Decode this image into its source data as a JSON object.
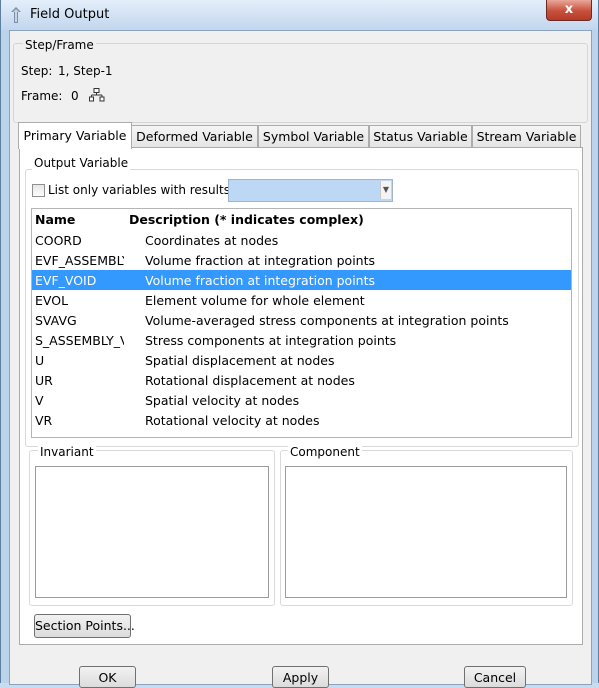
{
  "window": {
    "title": "Field Output",
    "close_glyph": "x"
  },
  "step_frame": {
    "group_label": "Step/Frame",
    "step_label": "Step:",
    "step_value": "1, Step-1",
    "frame_label": "Frame:",
    "frame_value": "0",
    "frame_icon": "tree-icon"
  },
  "tabs": [
    {
      "label": "Primary Variable",
      "active": true
    },
    {
      "label": "Deformed Variable",
      "active": false
    },
    {
      "label": "Symbol Variable",
      "active": false
    },
    {
      "label": "Status Variable",
      "active": false
    },
    {
      "label": "Stream Variable",
      "active": false
    }
  ],
  "output_variable": {
    "group_label": "Output Variable",
    "checkbox_label": "List only variables with results:",
    "checkbox_checked": false,
    "combo_value": "",
    "columns": [
      "Name",
      "Description (* indicates complex)"
    ],
    "rows": [
      {
        "name": "COORD",
        "description": "Coordinates at nodes",
        "selected": false
      },
      {
        "name": "EVF_ASSEMBLY",
        "description": "Volume fraction at integration points",
        "selected": false
      },
      {
        "name": "EVF_VOID",
        "description": "Volume fraction at integration points",
        "selected": true
      },
      {
        "name": "EVOL",
        "description": "Element volume for whole element",
        "selected": false
      },
      {
        "name": "SVAVG",
        "description": "Volume-averaged stress components at integration points",
        "selected": false
      },
      {
        "name": "S_ASSEMBLY_V",
        "description": "Stress components at integration points",
        "selected": false
      },
      {
        "name": "U",
        "description": "Spatial displacement at nodes",
        "selected": false
      },
      {
        "name": "UR",
        "description": "Rotational displacement at nodes",
        "selected": false
      },
      {
        "name": "V",
        "description": "Spatial velocity at nodes",
        "selected": false
      },
      {
        "name": "VR",
        "description": "Rotational velocity at nodes",
        "selected": false
      }
    ]
  },
  "invariant": {
    "group_label": "Invariant"
  },
  "component": {
    "group_label": "Component"
  },
  "buttons": {
    "section_points": "Section Points...",
    "ok": "OK",
    "apply": "Apply",
    "cancel": "Cancel"
  },
  "colors": {
    "selection": "#3399ff",
    "title_bar": "#c2d6ee"
  }
}
